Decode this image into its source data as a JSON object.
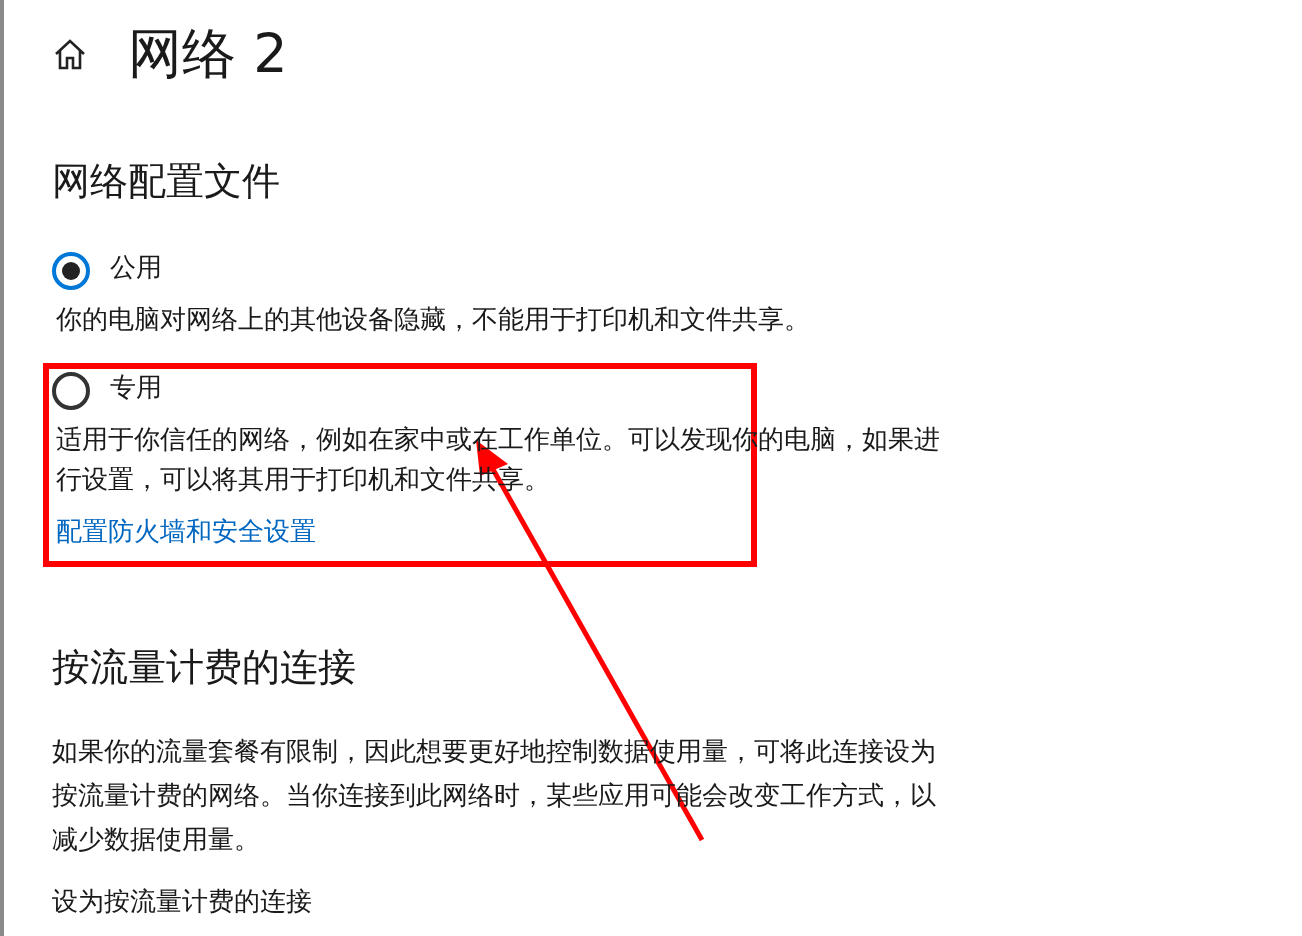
{
  "page": {
    "title": "网络 2"
  },
  "profile": {
    "heading": "网络配置文件",
    "options": [
      {
        "label": "公用",
        "selected": true,
        "description": "你的电脑对网络上的其他设备隐藏，不能用于打印机和文件共享。"
      },
      {
        "label": "专用",
        "selected": false,
        "description": "适用于你信任的网络，例如在家中或在工作单位。可以发现你的电脑，如果进行设置，可以将其用于打印机和文件共享。"
      }
    ],
    "link": "配置防火墙和安全设置"
  },
  "metered": {
    "heading": "按流量计费的连接",
    "description": "如果你的流量套餐有限制，因此想要更好地控制数据使用量，可将此连接设为按流量计费的网络。当你连接到此网络时，某些应用可能会改变工作方式，以减少数据使用量。",
    "setting_label": "设为按流量计费的连接"
  }
}
